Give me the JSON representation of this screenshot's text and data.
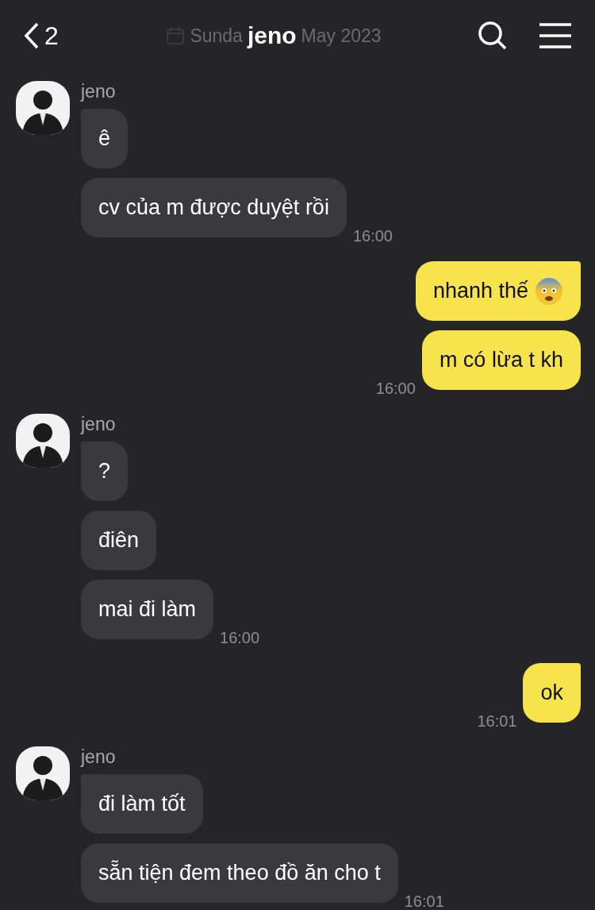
{
  "header": {
    "back_count": "2",
    "date_start": "Sunda",
    "title": "jeno",
    "date_end": "May 2023"
  },
  "groups": [
    {
      "kind": "received",
      "sender": "jeno",
      "messages": [
        {
          "kind": "text",
          "text": "ê"
        },
        {
          "kind": "text",
          "text": "cv của m được duyệt rồi",
          "time": "16:00"
        }
      ]
    },
    {
      "kind": "sent",
      "messages": [
        {
          "kind": "emoji",
          "text": "nhanh thế"
        },
        {
          "kind": "text",
          "text": "m có lừa t kh",
          "time": "16:00"
        }
      ]
    },
    {
      "kind": "received",
      "sender": "jeno",
      "messages": [
        {
          "kind": "text",
          "text": "?"
        },
        {
          "kind": "text",
          "text": "điên"
        },
        {
          "kind": "text",
          "text": "mai đi làm",
          "time": "16:00"
        }
      ]
    },
    {
      "kind": "sent",
      "messages": [
        {
          "kind": "text",
          "text": "ok",
          "time": "16:01"
        }
      ]
    },
    {
      "kind": "received",
      "sender": "jeno",
      "messages": [
        {
          "kind": "text",
          "text": "đi làm tốt"
        },
        {
          "kind": "text",
          "text": "sẵn tiện đem theo đồ ăn cho t",
          "time": "16:01"
        }
      ]
    }
  ]
}
